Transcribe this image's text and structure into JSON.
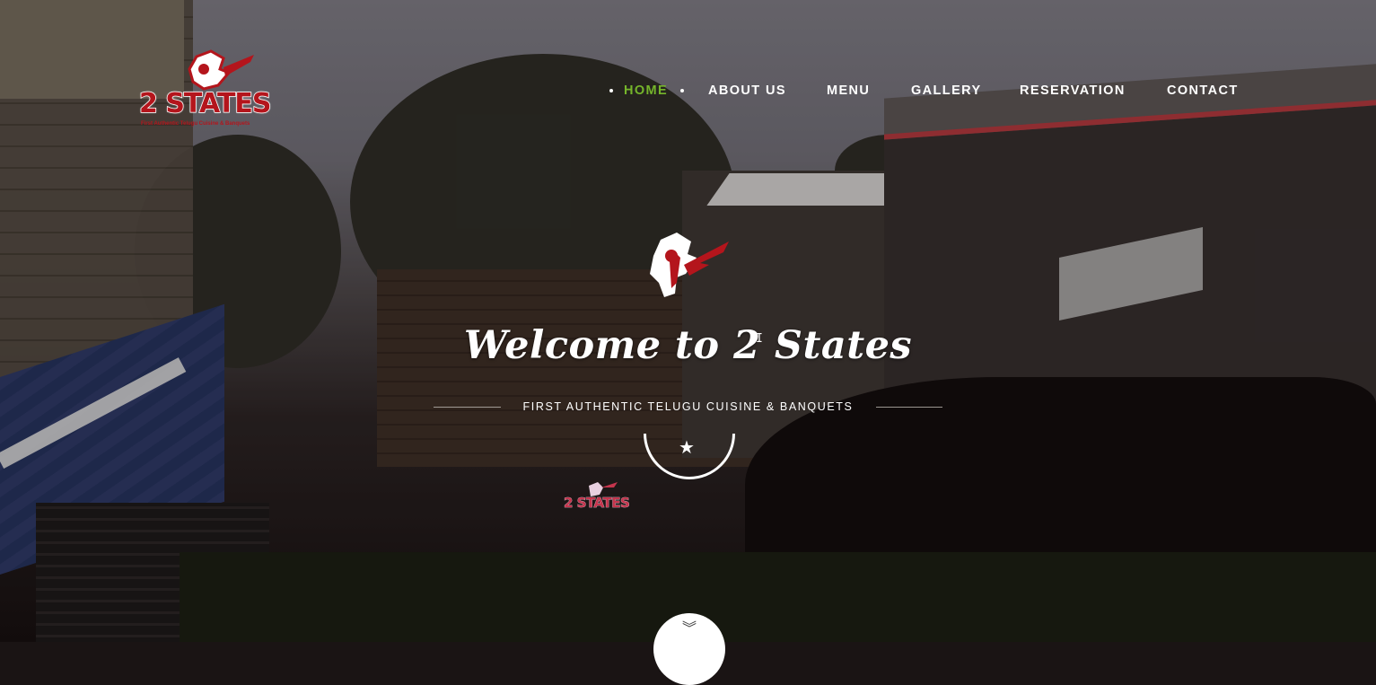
{
  "brand": {
    "logo_text": "2 STATES",
    "logo_tagline": "First Authentic Telugu Cuisine & Banquets",
    "accent_color": "#b4151c",
    "active_nav_color": "#75b52b"
  },
  "nav": {
    "items": [
      {
        "label": "HOME",
        "active": true
      },
      {
        "label": "ABOUT US",
        "active": false
      },
      {
        "label": "MENU",
        "active": false
      },
      {
        "label": "GALLERY",
        "active": false
      },
      {
        "label": "RESERVATION",
        "active": false
      },
      {
        "label": "CONTACT",
        "active": false
      }
    ]
  },
  "hero": {
    "title": "Welcome to 2 States",
    "subtitle": "FIRST AUTHENTIC TELUGU CUISINE & BANQUETS",
    "badge_icon": "star-icon",
    "wall_sign_text": "2 STATES"
  },
  "scroll": {
    "icon": "chevron-double-down-icon",
    "glyph": "︾"
  }
}
